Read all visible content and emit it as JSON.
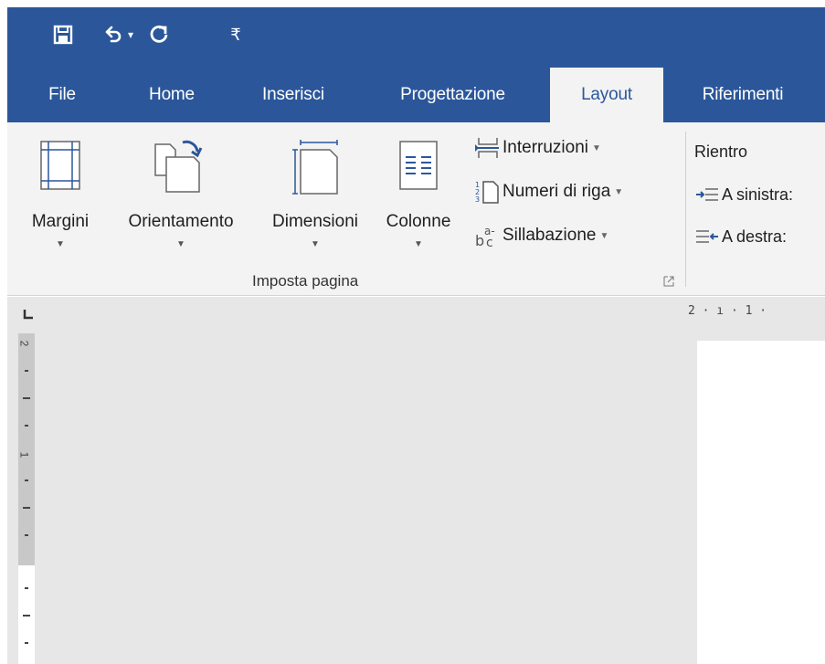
{
  "quick_access": {
    "save_icon": "save-icon",
    "undo_icon": "undo-icon",
    "redo_icon": "redo-icon",
    "customize_glyph": "₹"
  },
  "tabs": [
    {
      "label": "File"
    },
    {
      "label": "Home"
    },
    {
      "label": "Inserisci"
    },
    {
      "label": "Progettazione"
    },
    {
      "label": "Layout"
    },
    {
      "label": "Riferimenti"
    }
  ],
  "ribbon": {
    "margins_label": "Margini",
    "orientation_label": "Orientamento",
    "size_label": "Dimensioni",
    "columns_label": "Colonne",
    "breaks_label": "Interruzioni",
    "line_numbers_label": "Numeri di riga",
    "hyphenation_label": "Sillabazione",
    "group_label": "Imposta pagina",
    "indent_title": "Rientro",
    "indent_left_label": "A sinistra:",
    "indent_right_label": "A destra:"
  },
  "rulers": {
    "horizontal_text": "2 · ı · 1 ·",
    "vertical_marks": [
      "2",
      "1"
    ]
  },
  "colors": {
    "accent": "#2b579a",
    "ribbon_bg": "#f3f3f3",
    "doc_bg": "#e7e7e7"
  }
}
